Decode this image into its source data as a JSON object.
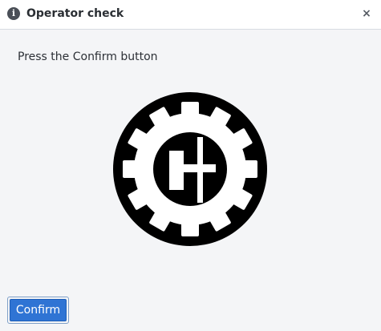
{
  "dialog": {
    "title": "Operator check",
    "info_icon_glyph": "i",
    "close_glyph": "×",
    "prompt": "Press the Confirm button",
    "logo_icon": "gear-emblem-icon",
    "confirm_label": "Confirm"
  },
  "colors": {
    "accent": "#2f74d4",
    "titlebar_bg": "#ffffff",
    "body_bg": "#f4f5f7",
    "logo": "#000000"
  }
}
